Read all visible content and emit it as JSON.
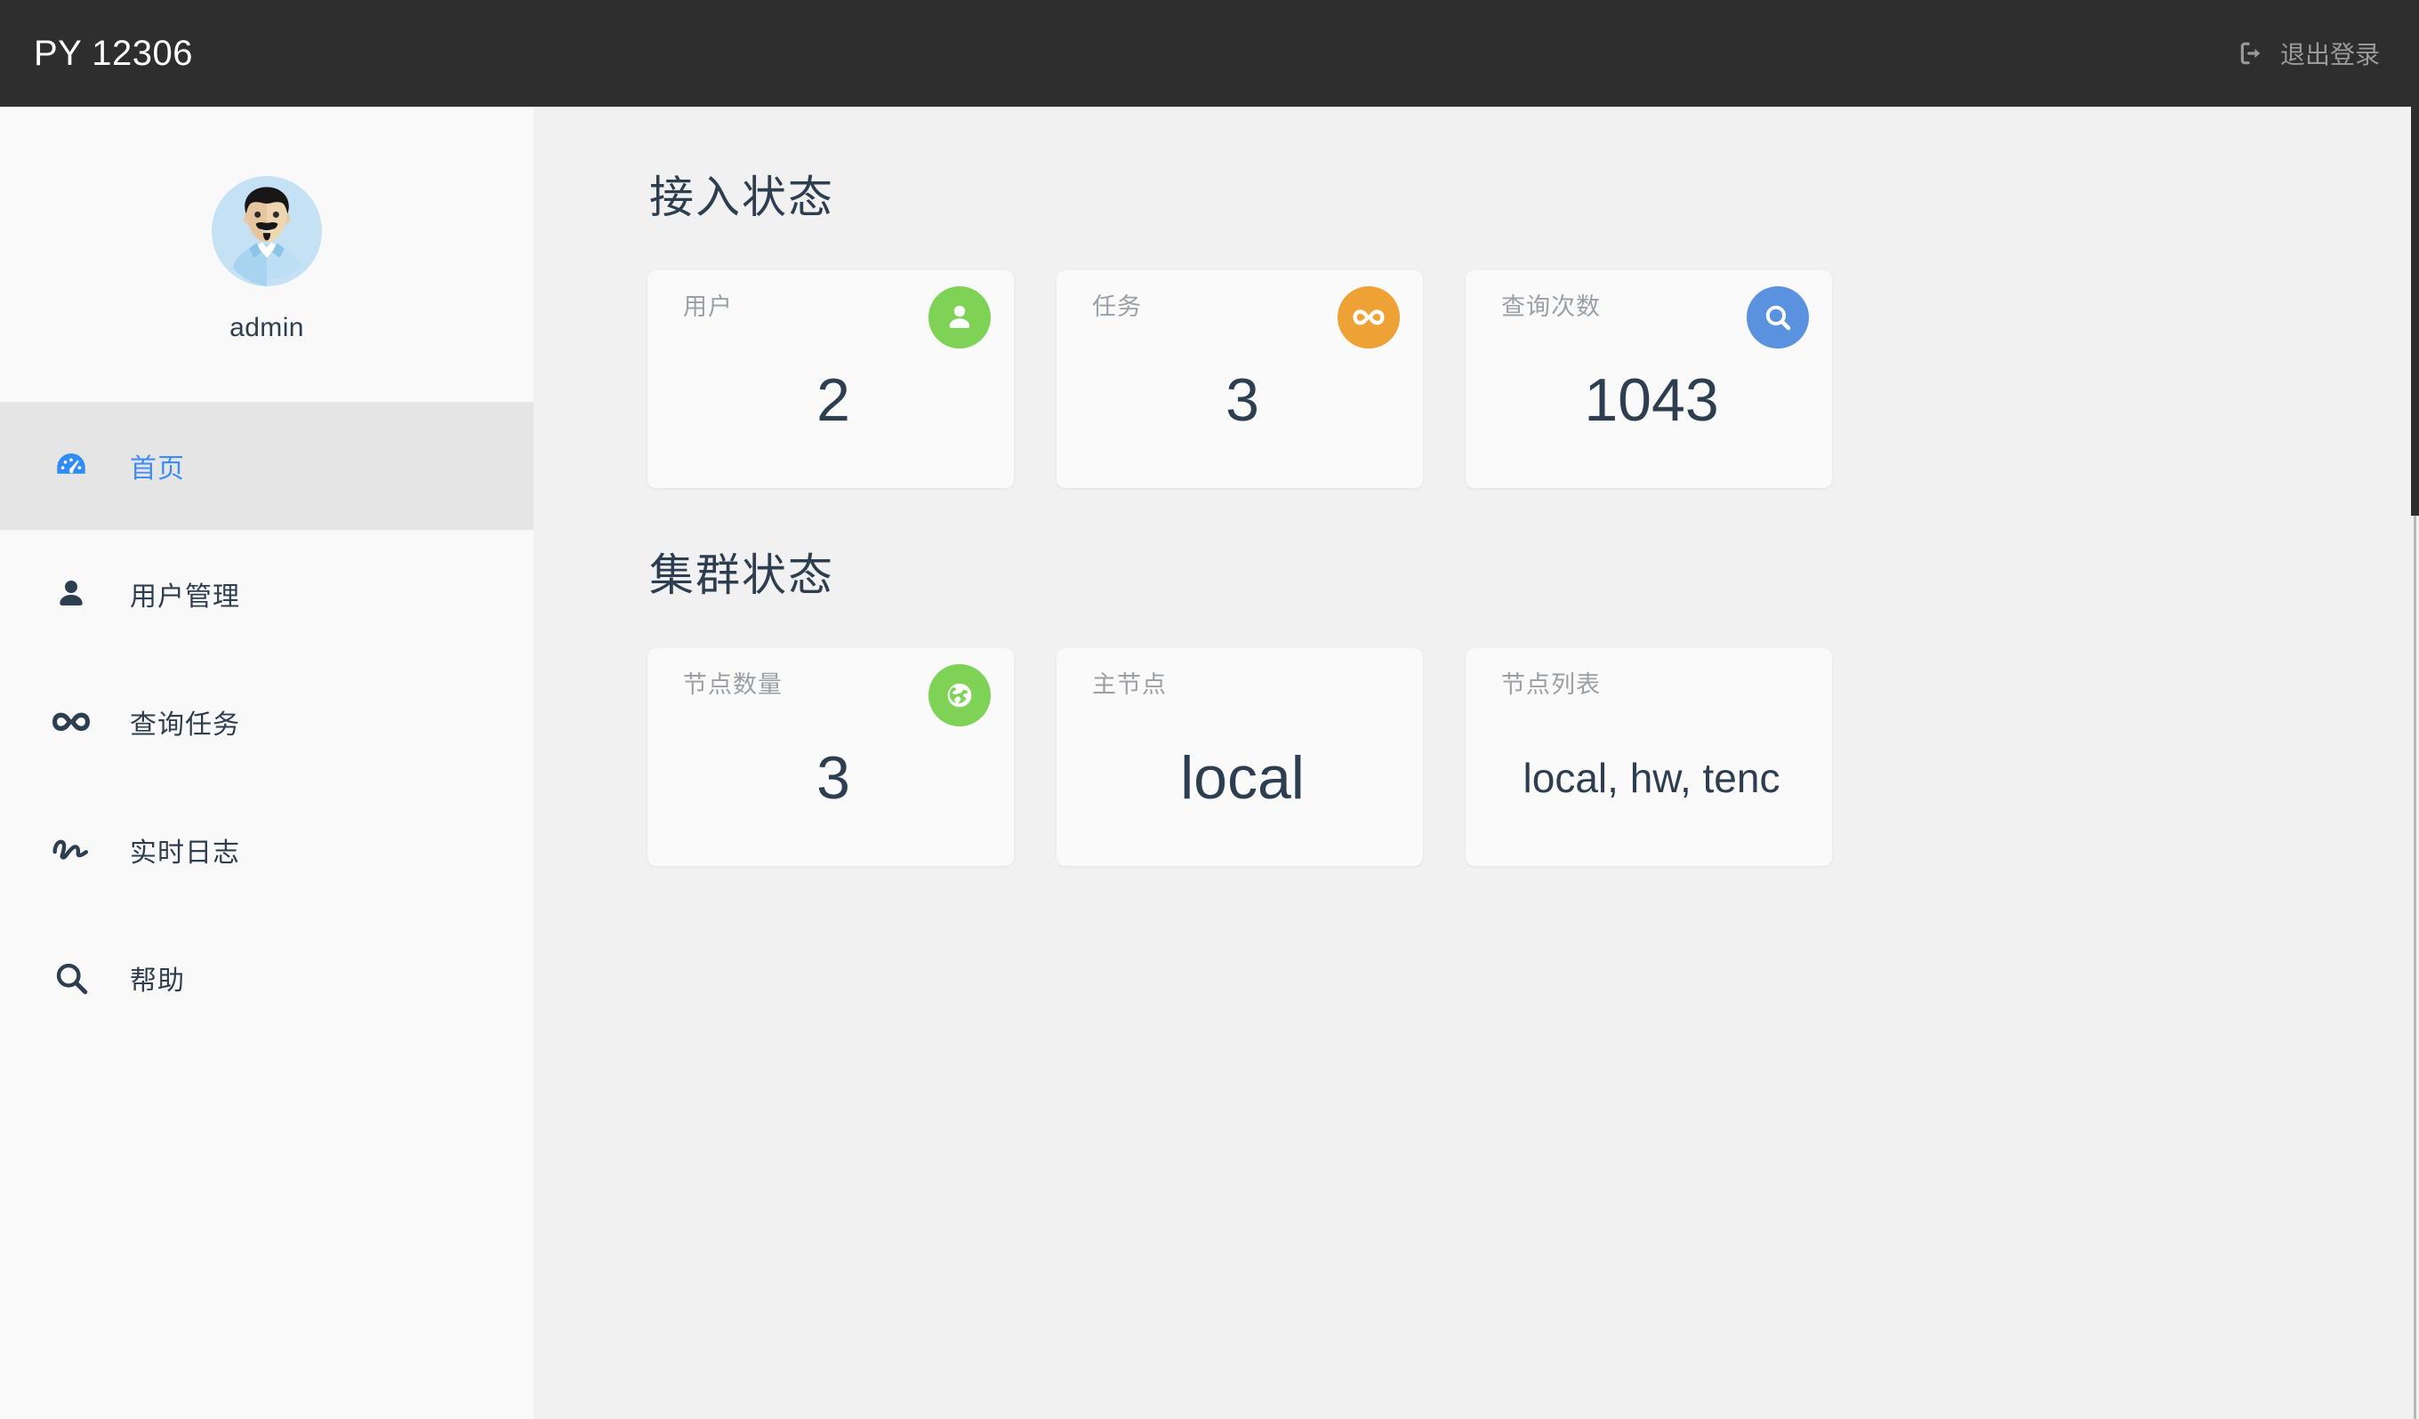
{
  "header": {
    "brand": "PY 12306",
    "logout_label": "退出登录",
    "logout_icon": "sign-out-icon",
    "background": "#2e2e2e",
    "brand_color": "#ffffff",
    "logout_color": "#9a9a98"
  },
  "sidebar": {
    "background": "#f9f9f9",
    "active_background": "#e5e5e5",
    "active_color": "#3d8df5",
    "profile": {
      "avatar_icon": "user-avatar",
      "username": "admin"
    },
    "items": [
      {
        "label": "首页",
        "icon": "dashboard-gauge-icon",
        "active": true
      },
      {
        "label": "用户管理",
        "icon": "user-icon",
        "active": false
      },
      {
        "label": "查询任务",
        "icon": "infinity-icon",
        "active": false
      },
      {
        "label": "实时日志",
        "icon": "activity-squiggle-icon",
        "active": false
      },
      {
        "label": "帮助",
        "icon": "search-icon",
        "active": false
      }
    ]
  },
  "main": {
    "sections": [
      {
        "title": "接入状态",
        "cards": [
          {
            "label": "用户",
            "value": "2",
            "icon": "user-icon",
            "icon_color": "#7ed356",
            "has_badge": true
          },
          {
            "label": "任务",
            "value": "3",
            "icon": "infinity-icon",
            "icon_color": "#eea236",
            "has_badge": true
          },
          {
            "label": "查询次数",
            "value": "1043",
            "icon": "search-icon",
            "icon_color": "#5b92e0",
            "has_badge": true
          }
        ]
      },
      {
        "title": "集群状态",
        "cards": [
          {
            "label": "节点数量",
            "value": "3",
            "icon": "globe-icon",
            "icon_color": "#7ed356",
            "has_badge": true
          },
          {
            "label": "主节点",
            "value": "local",
            "icon": "",
            "icon_color": "",
            "has_badge": false
          },
          {
            "label": "节点列表",
            "value": "local, hw, tenc",
            "icon": "",
            "icon_color": "",
            "has_badge": false
          }
        ]
      }
    ]
  },
  "scrollbar": {
    "visible": true
  }
}
